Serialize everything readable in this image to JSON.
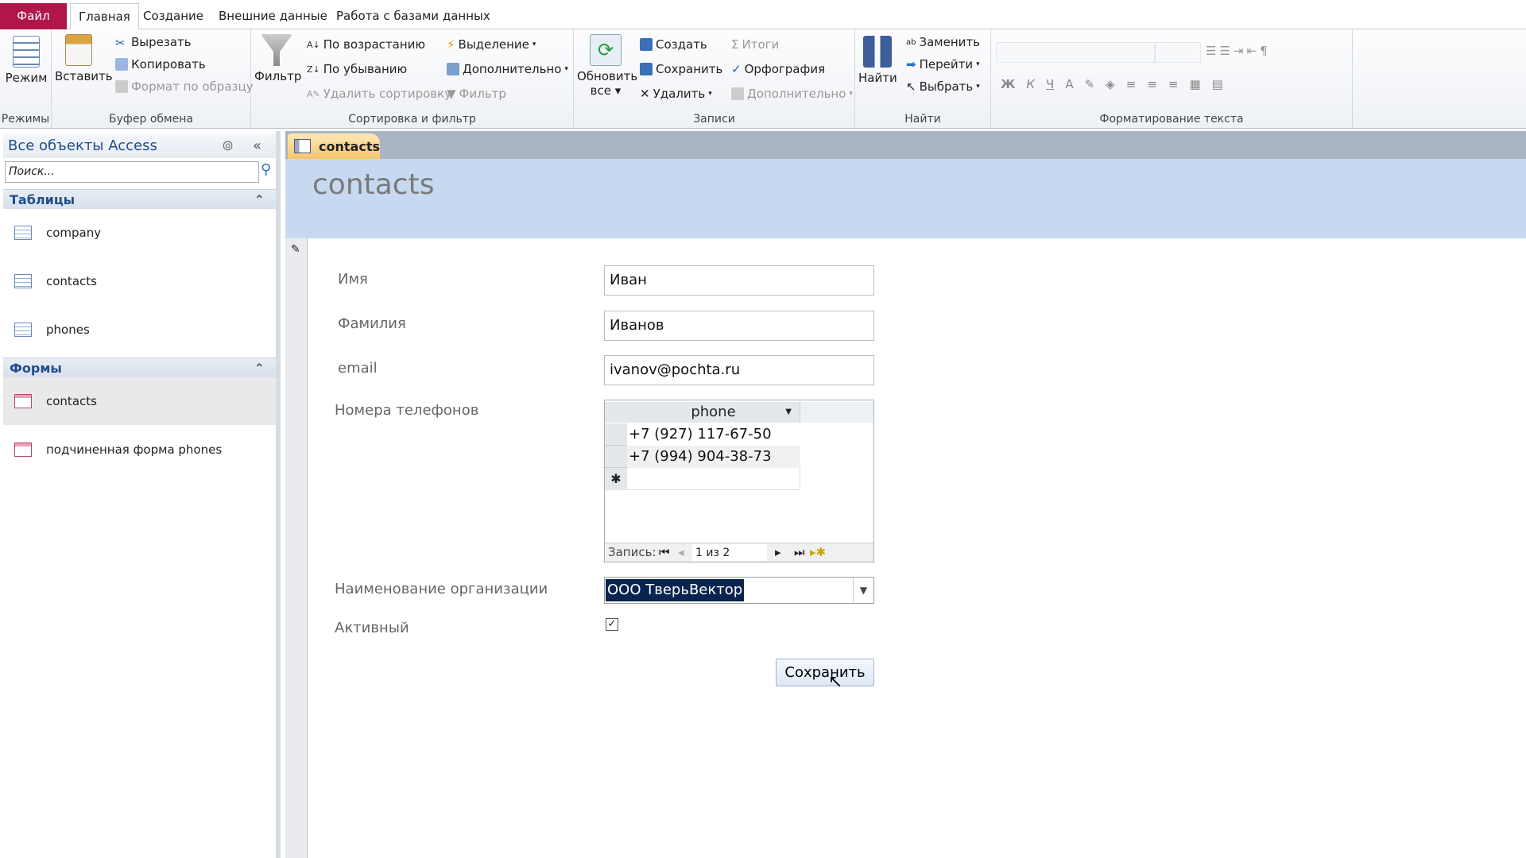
{
  "ribbon_tabs": [
    "Файл",
    "Главная",
    "Создание",
    "Внешние данные",
    "Работа с базами данных"
  ],
  "ribbon": {
    "groups": [
      "Режимы",
      "Буфер обмена",
      "Сортировка и фильтр",
      "Записи",
      "Найти",
      "Форматирование текста"
    ],
    "mode": "Режим",
    "paste": "Вставить",
    "cut": "Вырезать",
    "copy": "Копировать",
    "format_painter": "Формат по образцу",
    "filter": "Фильтр",
    "asc": "По возрастанию",
    "desc": "По убыванию",
    "clear_sort": "Удалить сортировку",
    "selection": "Выделение",
    "advanced": "Дополнительно",
    "toggle_filter": "Фильтр",
    "refresh_1": "Обновить",
    "refresh_2": "все",
    "new": "Создать",
    "save": "Сохранить",
    "delete": "Удалить",
    "totals": "Итоги",
    "spelling": "Орфография",
    "more": "Дополнительно",
    "find": "Найти",
    "replace": "Заменить",
    "goto": "Перейти",
    "select": "Выбрать",
    "bold": "Ж",
    "italic": "К",
    "underline": "Ч",
    "font_color": "A"
  },
  "nav": {
    "title": "Все объекты Access",
    "search_placeholder": "Поиск...",
    "sections": [
      {
        "label": "Таблицы",
        "items": [
          "company",
          "contacts",
          "phones"
        ]
      },
      {
        "label": "Формы",
        "items": [
          "contacts",
          "подчиненная форма phones"
        ]
      }
    ]
  },
  "document": {
    "tab": "contacts",
    "title": "contacts"
  },
  "form": {
    "first_name_label": "Имя",
    "first_name": "Иван",
    "last_name_label": "Фамилия",
    "last_name": "Иванов",
    "email_label": "email",
    "email": "ivanov@pochta.ru",
    "phones_label": "Номера телефонов",
    "phones": {
      "column": "phone",
      "rows": [
        "+7 (927) 117-67-50",
        "+7 (994) 904-38-73"
      ],
      "new_row": "✱",
      "nav_label": "Запись:",
      "nav_position": "1 из 2"
    },
    "org_label": "Наименование организации",
    "org": "ООО ТверьВектор",
    "active_label": "Активный",
    "active": true,
    "save_button": "Сохранить"
  }
}
